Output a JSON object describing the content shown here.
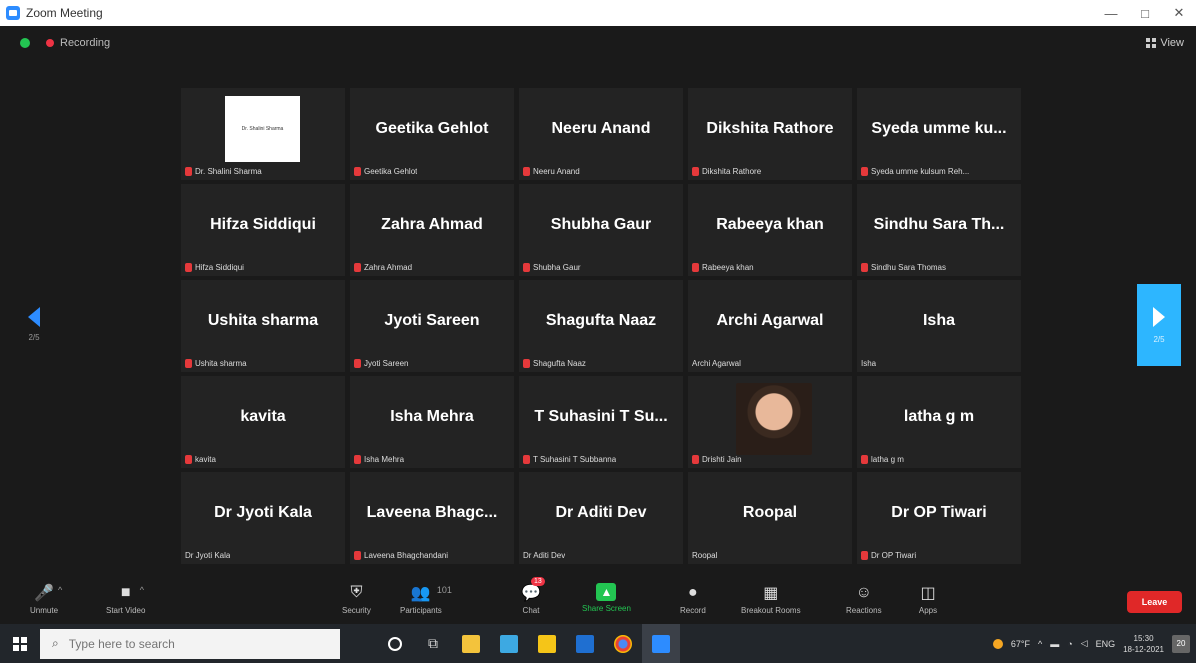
{
  "window": {
    "title": "Zoom Meeting",
    "minimize": "—",
    "maximize": "□",
    "close": "✕"
  },
  "topbar": {
    "recording": "Recording",
    "view": "View"
  },
  "nav": {
    "left_page": "2/5",
    "right_page": "2/5"
  },
  "tiles": [
    {
      "big": "",
      "label": "Dr. Shalini Sharma",
      "muted": true,
      "type": "slide",
      "slide_text": "Dr. Shalini Sharma"
    },
    {
      "big": "Geetika Gehlot",
      "label": "Geetika Gehlot",
      "muted": true
    },
    {
      "big": "Neeru Anand",
      "label": "Neeru Anand",
      "muted": true
    },
    {
      "big": "Dikshita Rathore",
      "label": "Dikshita Rathore",
      "muted": true
    },
    {
      "big": "Syeda umme ku...",
      "label": "Syeda umme kulsum Reh...",
      "muted": true
    },
    {
      "big": "Hifza Siddiqui",
      "label": "Hifza Siddiqui",
      "muted": true
    },
    {
      "big": "Zahra Ahmad",
      "label": "Zahra Ahmad",
      "muted": true
    },
    {
      "big": "Shubha Gaur",
      "label": "Shubha Gaur",
      "muted": true
    },
    {
      "big": "Rabeeya khan",
      "label": "Rabeeya khan",
      "muted": true
    },
    {
      "big": "Sindhu Sara Th...",
      "label": "Sindhu Sara Thomas",
      "muted": true
    },
    {
      "big": "Ushita sharma",
      "label": "Ushita sharma",
      "muted": true
    },
    {
      "big": "Jyoti Sareen",
      "label": "Jyoti Sareen",
      "muted": true
    },
    {
      "big": "Shagufta Naaz",
      "label": "Shagufta Naaz",
      "muted": true
    },
    {
      "big": "Archi Agarwal",
      "label": "Archi Agarwal",
      "muted": false
    },
    {
      "big": "Isha",
      "label": "Isha",
      "muted": false
    },
    {
      "big": "kavita",
      "label": "kavita",
      "muted": true
    },
    {
      "big": "Isha Mehra",
      "label": "Isha Mehra",
      "muted": true
    },
    {
      "big": "T Suhasini  T Su...",
      "label": "T Suhasini  T Subbanna",
      "muted": true
    },
    {
      "big": "",
      "label": "Drishti Jain",
      "muted": true,
      "type": "photo"
    },
    {
      "big": "latha g m",
      "label": "latha g m",
      "muted": true
    },
    {
      "big": "Dr Jyoti Kala",
      "label": "Dr Jyoti Kala",
      "muted": false
    },
    {
      "big": "Laveena  Bhagc...",
      "label": "Laveena Bhagchandani",
      "muted": true
    },
    {
      "big": "Dr Aditi Dev",
      "label": "Dr Aditi Dev",
      "muted": false
    },
    {
      "big": "Roopal",
      "label": "Roopal",
      "muted": false
    },
    {
      "big": "Dr OP Tiwari",
      "label": "Dr OP Tiwari",
      "muted": true
    }
  ],
  "toolbar": {
    "unmute": "Unmute",
    "start_video": "Start Video",
    "security": "Security",
    "participants": "Participants",
    "participants_count": "101",
    "chat": "Chat",
    "chat_badge": "13",
    "share_screen": "Share Screen",
    "record": "Record",
    "breakout": "Breakout Rooms",
    "reactions": "Reactions",
    "apps": "Apps",
    "leave": "Leave"
  },
  "taskbar": {
    "search_placeholder": "Type here to search",
    "temperature": "67°F",
    "language": "ENG",
    "time": "15:30",
    "date": "18-12-2021",
    "notifications": "20"
  }
}
